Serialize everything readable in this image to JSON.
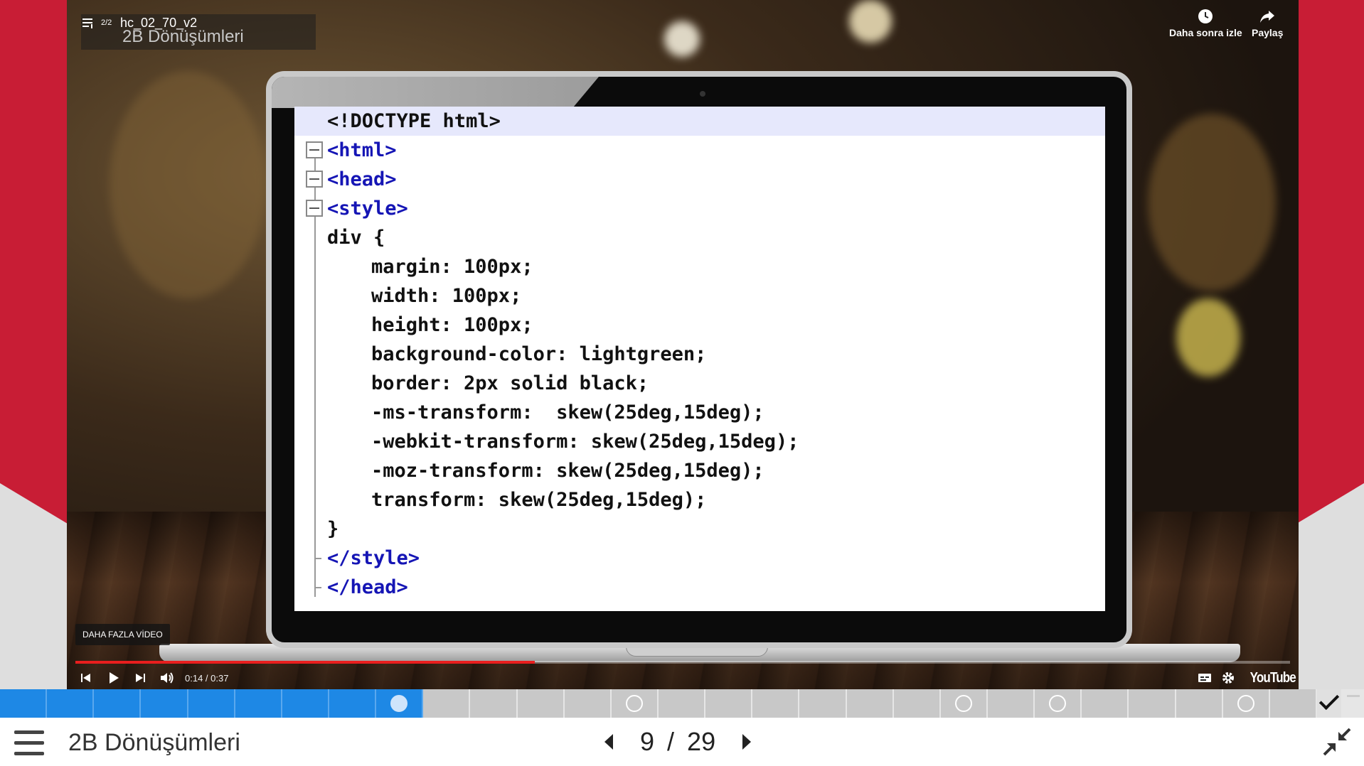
{
  "player": {
    "playlist_position": "2/2",
    "video_title": "hc_02_70_v2",
    "video_subtitle": "2B Dönüşümleri",
    "watch_later_label": "Daha sonra izle",
    "share_label": "Paylaş",
    "more_videos_label": "DAHA FAZLA VİDEO",
    "time_display": "0:14 / 0:37",
    "progress_fraction": 0.378,
    "youtube_label": "YouTube",
    "accent_color": "#e81e1e"
  },
  "code_lines": [
    {
      "parts": [
        {
          "text": "<!DOCTYPE html>",
          "cls": ""
        }
      ],
      "indent": 0,
      "highlight": true,
      "fold": false
    },
    {
      "parts": [
        {
          "text": "<html>",
          "cls": "tag"
        }
      ],
      "indent": 0,
      "highlight": false,
      "fold": true
    },
    {
      "parts": [
        {
          "text": "<head>",
          "cls": "tag"
        }
      ],
      "indent": 0,
      "highlight": false,
      "fold": true
    },
    {
      "parts": [
        {
          "text": "<style>",
          "cls": "tag"
        }
      ],
      "indent": 0,
      "highlight": false,
      "fold": true
    },
    {
      "parts": [
        {
          "text": "div {",
          "cls": ""
        }
      ],
      "indent": 0,
      "highlight": false,
      "fold": false
    },
    {
      "parts": [
        {
          "text": "margin: 100px;",
          "cls": ""
        }
      ],
      "indent": 1,
      "highlight": false,
      "fold": false
    },
    {
      "parts": [
        {
          "text": "width: 100px;",
          "cls": ""
        }
      ],
      "indent": 1,
      "highlight": false,
      "fold": false
    },
    {
      "parts": [
        {
          "text": "height: 100px;",
          "cls": ""
        }
      ],
      "indent": 1,
      "highlight": false,
      "fold": false
    },
    {
      "parts": [
        {
          "text": "background-color: lightgreen;",
          "cls": ""
        }
      ],
      "indent": 1,
      "highlight": false,
      "fold": false
    },
    {
      "parts": [
        {
          "text": "border: 2px solid black;",
          "cls": ""
        }
      ],
      "indent": 1,
      "highlight": false,
      "fold": false
    },
    {
      "parts": [
        {
          "text": "-ms-transform:  skew(25deg,15deg);",
          "cls": ""
        }
      ],
      "indent": 1,
      "highlight": false,
      "fold": false
    },
    {
      "parts": [
        {
          "text": "-webkit-transform: skew(25deg,15deg);",
          "cls": ""
        }
      ],
      "indent": 1,
      "highlight": false,
      "fold": false
    },
    {
      "parts": [
        {
          "text": "-moz-transform: skew(25deg,15deg);",
          "cls": ""
        }
      ],
      "indent": 1,
      "highlight": false,
      "fold": false
    },
    {
      "parts": [
        {
          "text": "transform: skew(25deg,15deg);",
          "cls": ""
        }
      ],
      "indent": 1,
      "highlight": false,
      "fold": false
    },
    {
      "parts": [
        {
          "text": "}",
          "cls": ""
        }
      ],
      "indent": 0,
      "highlight": false,
      "fold": false
    },
    {
      "parts": [
        {
          "text": "</style>",
          "cls": "tag"
        }
      ],
      "indent": 0,
      "highlight": false,
      "fold": false
    },
    {
      "parts": [
        {
          "text": "</head>",
          "cls": "tag"
        }
      ],
      "indent": 0,
      "highlight": false,
      "fold": false
    }
  ],
  "course_progress": {
    "total_segments": 28,
    "completed_segments": 9,
    "current_segment": 8,
    "circle_segments": [
      8,
      13,
      20,
      22,
      26
    ],
    "completed_color": "#1e88e5",
    "remaining_color": "#c8c8c8"
  },
  "footer": {
    "lesson_title": "2B Dönüşümleri",
    "current_page": "9",
    "separator": "/",
    "total_pages": "29"
  }
}
